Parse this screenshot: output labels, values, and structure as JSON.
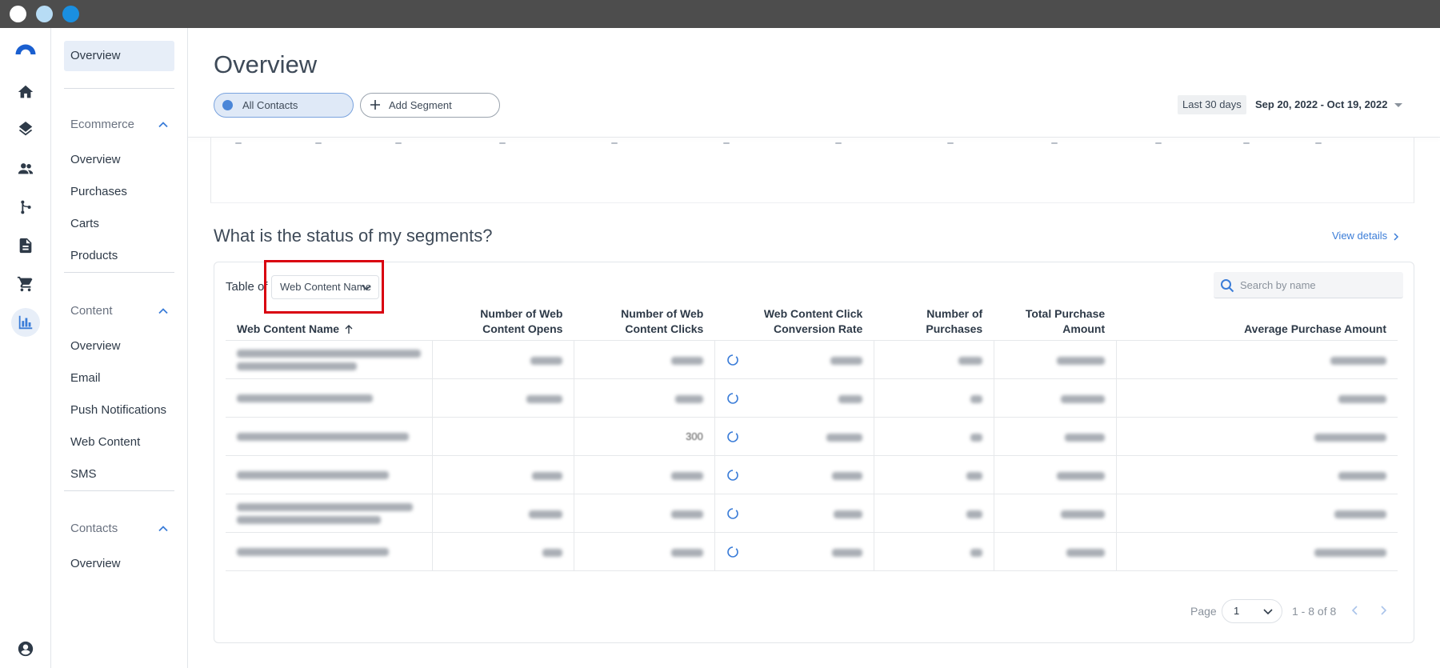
{
  "window": {
    "traffic_lights": [
      "#ffffff",
      "#b7dcf5",
      "#1a8fe0"
    ]
  },
  "rail": {
    "icons": [
      "logo-icon",
      "home-icon",
      "layers-icon",
      "contacts-icon",
      "automation-icon",
      "document-icon",
      "cart-icon",
      "reports-icon",
      "account-icon"
    ]
  },
  "sidebar": {
    "top_item": "Overview",
    "groups": [
      {
        "label": "Ecommerce",
        "items": [
          "Overview",
          "Purchases",
          "Carts",
          "Products"
        ]
      },
      {
        "label": "Content",
        "items": [
          "Overview",
          "Email",
          "Push Notifications",
          "Web Content",
          "SMS"
        ]
      },
      {
        "label": "Contacts",
        "items": [
          "Overview"
        ]
      }
    ]
  },
  "header": {
    "title": "Overview",
    "segments": {
      "all": "All Contacts",
      "add": "Add Segment"
    },
    "range_label": "Last 30 days",
    "date_range": "Sep 20, 2022 - Oct 19, 2022"
  },
  "section": {
    "title": "What is the status of my segments?",
    "view_details": "View details"
  },
  "table_card": {
    "table_of_label": "Table of",
    "selected": "Web Content Name",
    "search_placeholder": "Search by name",
    "columns": [
      "Web Content Name",
      "Number of Web Content Opens",
      "Number of Web Content Clicks",
      "Web Content Click Conversion Rate",
      "Number of Purchases",
      "Total Purchase Amount",
      "Average Purchase Amount"
    ],
    "rows": [
      {
        "clicks_visible": ""
      },
      {
        "clicks_visible": ""
      },
      {
        "clicks_visible": "300"
      },
      {
        "clicks_visible": ""
      },
      {
        "clicks_visible": ""
      },
      {
        "clicks_visible": ""
      }
    ],
    "pager": {
      "label": "Page",
      "page": "1",
      "count": "1 - 8 of 8"
    }
  },
  "colors": {
    "accent": "#3b7dd8",
    "highlight": "#d90010"
  }
}
